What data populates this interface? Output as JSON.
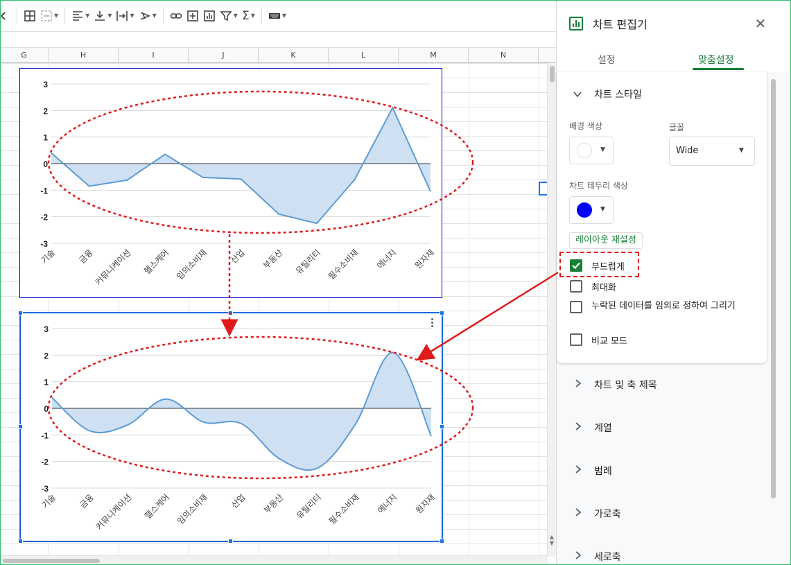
{
  "toolbar": {
    "icons": [
      "move-icon",
      "table-icon",
      "merge-cells-icon",
      "align-horizontal-icon",
      "align-vertical-icon",
      "text-wrap-icon",
      "text-rotate-icon",
      "link-icon",
      "comment-icon",
      "chart-icon",
      "filter-icon",
      "function-icon",
      "keyboard-icon"
    ]
  },
  "columns": [
    "G",
    "H",
    "I",
    "J",
    "K",
    "L",
    "M",
    "N"
  ],
  "chart_data": [
    {
      "type": "area",
      "categories": [
        "기술",
        "금융",
        "커뮤니케이션",
        "헬스케어",
        "임의소비재",
        "산업",
        "부동산",
        "유틸리티",
        "필수소비재",
        "에너지",
        "원자재"
      ],
      "values": [
        0.4,
        -0.85,
        -0.62,
        0.35,
        -0.52,
        -0.58,
        -1.9,
        -2.25,
        -0.6,
        2.1,
        -1.05
      ],
      "smooth": false,
      "ylim": [
        -3,
        3
      ],
      "yticks": [
        "3",
        "2",
        "1",
        "0",
        "-1",
        "-2",
        "-3"
      ],
      "grid": true,
      "title": "",
      "xlabel": "",
      "ylabel": ""
    },
    {
      "type": "area",
      "categories": [
        "기술",
        "금융",
        "커뮤니케이션",
        "헬스케어",
        "임의소비재",
        "산업",
        "부동산",
        "유틸리티",
        "필수소비재",
        "에너지",
        "원자재"
      ],
      "values": [
        0.4,
        -0.85,
        -0.62,
        0.35,
        -0.52,
        -0.58,
        -1.9,
        -2.25,
        -0.6,
        2.1,
        -1.05
      ],
      "smooth": true,
      "ylim": [
        -3,
        3
      ],
      "yticks": [
        "3",
        "2",
        "1",
        "0",
        "-1",
        "-2",
        "-3"
      ],
      "grid": true,
      "title": "",
      "xlabel": "",
      "ylabel": ""
    }
  ],
  "colors": {
    "series_line": "#5b9bd5",
    "series_fill": "#cfe0f3",
    "annotation": "#e0191b",
    "accent": "#188038"
  },
  "panel": {
    "title": "차트 편집기",
    "tabs": [
      "설정",
      "맞춤설정"
    ],
    "active_tab": "맞춤설정",
    "section_chart_style": "차트 스타일",
    "bg_color_label": "배경 색상",
    "font_label": "글꼴",
    "font_value": "Wide",
    "border_color_label": "차트 테두리 색상",
    "border_color": "#0000ff",
    "reset_layout": "레이아웃 재설정",
    "checkboxes": [
      {
        "label": "부드럽게",
        "checked": true
      },
      {
        "label": "최대화",
        "checked": false
      },
      {
        "label": "누락된 데이터를 임의로 정하여 그리기",
        "checked": false
      },
      {
        "label": "비교 모드",
        "checked": false
      }
    ],
    "collapsed_sections": [
      "차트 및 축 제목",
      "계열",
      "범례",
      "가로축",
      "세로축"
    ]
  }
}
